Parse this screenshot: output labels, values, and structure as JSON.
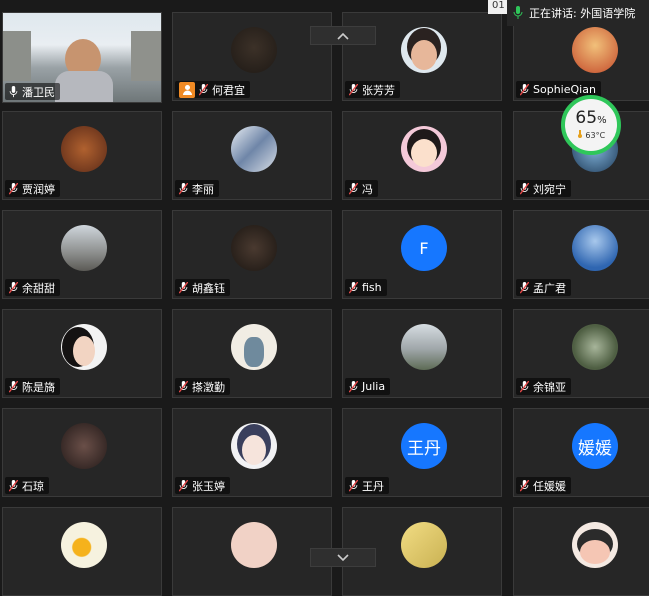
{
  "header": {
    "tab_text": "01",
    "speaking_label": "正在讲话: 外国语学院",
    "colors": {
      "mic_active": "#2fc75a",
      "mic_muted": "#e84a4a"
    }
  },
  "monitor": {
    "percent": "65",
    "unit": "%",
    "temp": "63°C"
  },
  "participants": [
    {
      "name": "潘卫民",
      "mic": "on",
      "avatar": "video"
    },
    {
      "name": "何君宜",
      "mic": "off",
      "avatar": "person-icon"
    },
    {
      "name": "张芳芳",
      "mic": "off",
      "avatar": "photo"
    },
    {
      "name": "SophieQian",
      "mic": "off",
      "avatar": "photo"
    },
    {
      "name": "贾润婷",
      "mic": "off",
      "avatar": "photo"
    },
    {
      "name": "李丽",
      "mic": "off",
      "avatar": "photo"
    },
    {
      "name": "冯",
      "mic": "off",
      "avatar": "photo"
    },
    {
      "name": "刘宛宁",
      "mic": "off",
      "avatar": "photo"
    },
    {
      "name": "余甜甜",
      "mic": "off",
      "avatar": "photo"
    },
    {
      "name": "胡鑫钰",
      "mic": "off",
      "avatar": "photo"
    },
    {
      "name": "fish",
      "mic": "off",
      "avatar": "letter",
      "letter": "F"
    },
    {
      "name": "孟广君",
      "mic": "off",
      "avatar": "photo"
    },
    {
      "name": "陈是旖",
      "mic": "off",
      "avatar": "photo"
    },
    {
      "name": "搽澂勤",
      "mic": "off",
      "avatar": "photo"
    },
    {
      "name": "Julia",
      "mic": "off",
      "avatar": "photo"
    },
    {
      "name": "余锦亚",
      "mic": "off",
      "avatar": "photo"
    },
    {
      "name": "石琼",
      "mic": "off",
      "avatar": "photo"
    },
    {
      "name": "张玉婷",
      "mic": "off",
      "avatar": "photo"
    },
    {
      "name": "王丹",
      "mic": "off",
      "avatar": "letter",
      "letter": "王丹"
    },
    {
      "name": "任媛媛",
      "mic": "off",
      "avatar": "letter",
      "letter": "媛媛"
    }
  ],
  "partial_row": 4
}
